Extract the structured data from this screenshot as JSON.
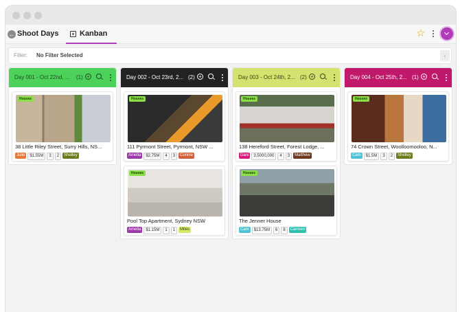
{
  "app": {
    "title": "Shoot Days",
    "active_tab": "Kanban"
  },
  "filter": {
    "label": "Filter:",
    "value": "No Filter Selected"
  },
  "colors": {
    "accent": "#b03ab7",
    "star": "#f0a70a"
  },
  "icons": [
    "back-icon",
    "kanban-icon",
    "star-icon",
    "more-icon",
    "chevron-down-icon",
    "add-icon",
    "zoom-in-icon"
  ],
  "columns": [
    {
      "title": "Day 001 - Oct 22nd, ...",
      "count": "(1)",
      "color": "#4cd15a",
      "text_color": "#1e4d20",
      "cards": [
        {
          "tag": "Houses",
          "address": "38 Little Riley Street, Surry Hills, NS...",
          "agent": "Julie",
          "agent_color": "#e8793a",
          "price": "$1.55M",
          "beds": "3",
          "baths": "2",
          "contact": "Shelley",
          "contact_color": "#6b7a1c"
        }
      ]
    },
    {
      "title": "Day 002 - Oct 23rd, 2...",
      "count": "(2)",
      "color": "#222222",
      "text_color": "#ffffff",
      "cards": [
        {
          "tag": "Houses",
          "address": "111 Pyrmont Street, Pyrmont, NSW ...",
          "agent": "Amelia",
          "agent_color": "#9b3aa8",
          "price": "$2.75M",
          "beds": "4",
          "baths": "3",
          "contact": "Connie",
          "contact_color": "#d2603a"
        },
        {
          "tag": "Houses",
          "address": "Pool Top Apartment, Sydney NSW",
          "agent": "Amelia",
          "agent_color": "#9b3aa8",
          "price": "$1.15M",
          "beds": "1",
          "baths": "1",
          "contact": "Miles",
          "contact_color": "#d6e76a"
        }
      ]
    },
    {
      "title": "Day 003 - Oct 24th, 2...",
      "count": "(2)",
      "color": "#d4e36f",
      "text_color": "#3c4310",
      "cards": [
        {
          "tag": "Houses",
          "address": "138 Hereford Street, Forest Lodge, ...",
          "agent": "Dani",
          "agent_color": "#d81b7a",
          "price": "3,5000,000",
          "beds": "4",
          "baths": "3",
          "contact": "Matthew",
          "contact_color": "#6e3a1e"
        },
        {
          "tag": "Houses",
          "address": "The Jenner House",
          "agent": "Cam",
          "agent_color": "#4fc3d3",
          "price": "$13.75M",
          "beds": "6",
          "baths": "8",
          "contact": "Carmen",
          "contact_color": "#2fbfae"
        }
      ]
    },
    {
      "title": "Day 004 - Oct 25th, 2...",
      "count": "(1)",
      "color": "#c0186b",
      "text_color": "#ffffff",
      "cards": [
        {
          "tag": "Houses",
          "address": "74 Crown Street, Woolloomooloo, N...",
          "agent": "Cam",
          "agent_color": "#4fc3d3",
          "price": "$1.5M",
          "beds": "3",
          "baths": "2",
          "contact": "Shelley",
          "contact_color": "#6b7a1c"
        }
      ]
    }
  ]
}
